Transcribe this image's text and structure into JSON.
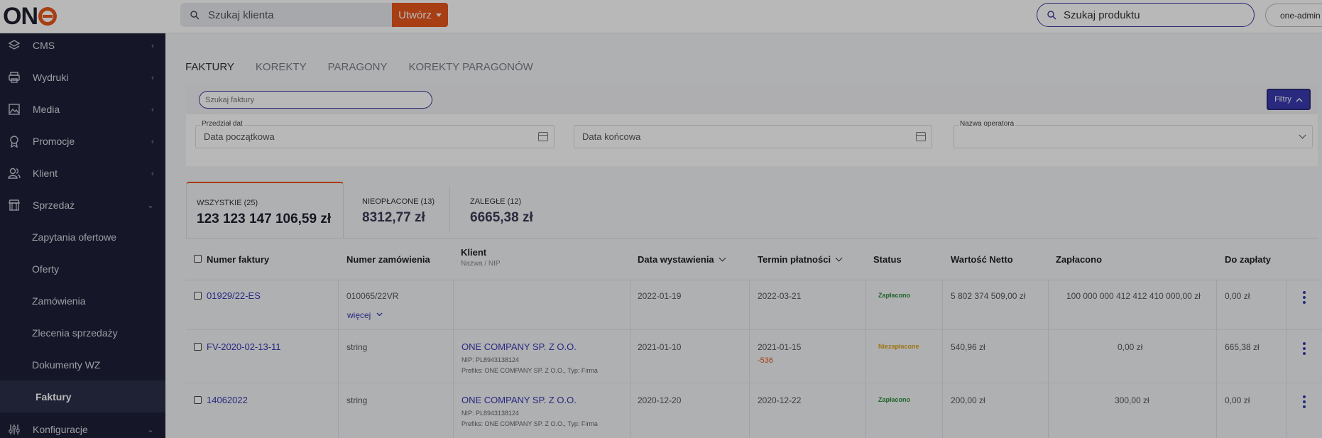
{
  "header": {
    "logo_text": "ON",
    "client_search_placeholder": "Szukaj klienta",
    "create_label": "Utwórz",
    "product_search_placeholder": "Szukaj produktu",
    "user_label": "one-admin"
  },
  "sidebar": {
    "items": [
      {
        "label": "CMS",
        "icon": "layers-icon"
      },
      {
        "label": "Wydruki",
        "icon": "printer-icon"
      },
      {
        "label": "Media",
        "icon": "image-icon"
      },
      {
        "label": "Promocje",
        "icon": "badge-icon"
      },
      {
        "label": "Klient",
        "icon": "users-icon"
      },
      {
        "label": "Sprzedaż",
        "icon": "shop-icon"
      }
    ],
    "sub_items": [
      "Zapytania ofertowe",
      "Oferty",
      "Zamówienia",
      "Zlecenia sprzedaży",
      "Dokumenty WZ",
      "Faktury"
    ],
    "bottom_item": {
      "label": "Konfiguracje",
      "icon": "sliders-icon"
    }
  },
  "tabs": [
    "FAKTURY",
    "KOREKTY",
    "PARAGONY",
    "KOREKTY PARAGONÓW"
  ],
  "filters": {
    "invoice_search_placeholder": "Szukaj faktury",
    "filter_button": "Filtry",
    "date_range_label": "Przedział dat",
    "date_start_placeholder": "Data początkowa",
    "date_end_placeholder": "Data końcowa",
    "operator_label": "Nazwa operatora"
  },
  "summary": [
    {
      "label": "WSZYSTKIE (25)",
      "value": "123 123 147 106,59 zł"
    },
    {
      "label": "NIEOPŁACONE (13)",
      "value": "8312,77 zł"
    },
    {
      "label": "ZALEGŁE (12)",
      "value": "6665,38 zł"
    }
  ],
  "table": {
    "columns": {
      "invoice_number": "Numer faktury",
      "order_number": "Numer zamówienia",
      "client": "Klient",
      "client_sub": "Nazwa / NIP",
      "issue_date": "Data wystawienia",
      "due_date": "Termin płatności",
      "status": "Status",
      "net_value": "Wartość Netto",
      "paid": "Zapłacono",
      "to_pay": "Do zapłaty"
    },
    "rows": [
      {
        "invoice_number": "01929/22-ES",
        "order_number": "010065/22VR",
        "more_label": "więcej",
        "client_name": "",
        "client_nip": "",
        "client_prefix": "",
        "issue_date": "2022-01-19",
        "due_date": "2022-03-21",
        "overdue": "",
        "status": "Zapłacono",
        "net_value": "5 802 374 509,00 zł",
        "paid": "100 000 000 412 412 410 000,00 zł",
        "to_pay": "0,00 zł"
      },
      {
        "invoice_number": "FV-2020-02-13-11",
        "order_number": "string",
        "more_label": "",
        "client_name": "ONE COMPANY SP. Z O.O.",
        "client_nip": "NIP: PL8943138124",
        "client_prefix": "Prefiks: ONE COMPANY SP. Z O.O., Typ: Firma",
        "issue_date": "2021-01-10",
        "due_date": "2021-01-15",
        "overdue": "-536",
        "status": "Niezapłacone",
        "net_value": "540,96 zł",
        "paid": "0,00 zł",
        "to_pay": "665,38 zł"
      },
      {
        "invoice_number": "14062022",
        "order_number": "string",
        "more_label": "",
        "client_name": "ONE COMPANY SP. Z O.O.",
        "client_nip": "NIP: PL8943138124",
        "client_prefix": "Prefiks: ONE COMPANY SP. Z O.O., Typ: Firma",
        "issue_date": "2020-12-20",
        "due_date": "2020-12-22",
        "overdue": "",
        "status": "Zapłacono",
        "net_value": "200,00 zł",
        "paid": "300,00 zł",
        "to_pay": "0,00 zł"
      }
    ]
  },
  "colors": {
    "accent": "#e8561d",
    "primary": "#3a3ab0",
    "sidebar": "#1e2138",
    "paid": "#2e8b3a",
    "unpaid": "#d9a21a",
    "overdue": "#e8561d"
  }
}
